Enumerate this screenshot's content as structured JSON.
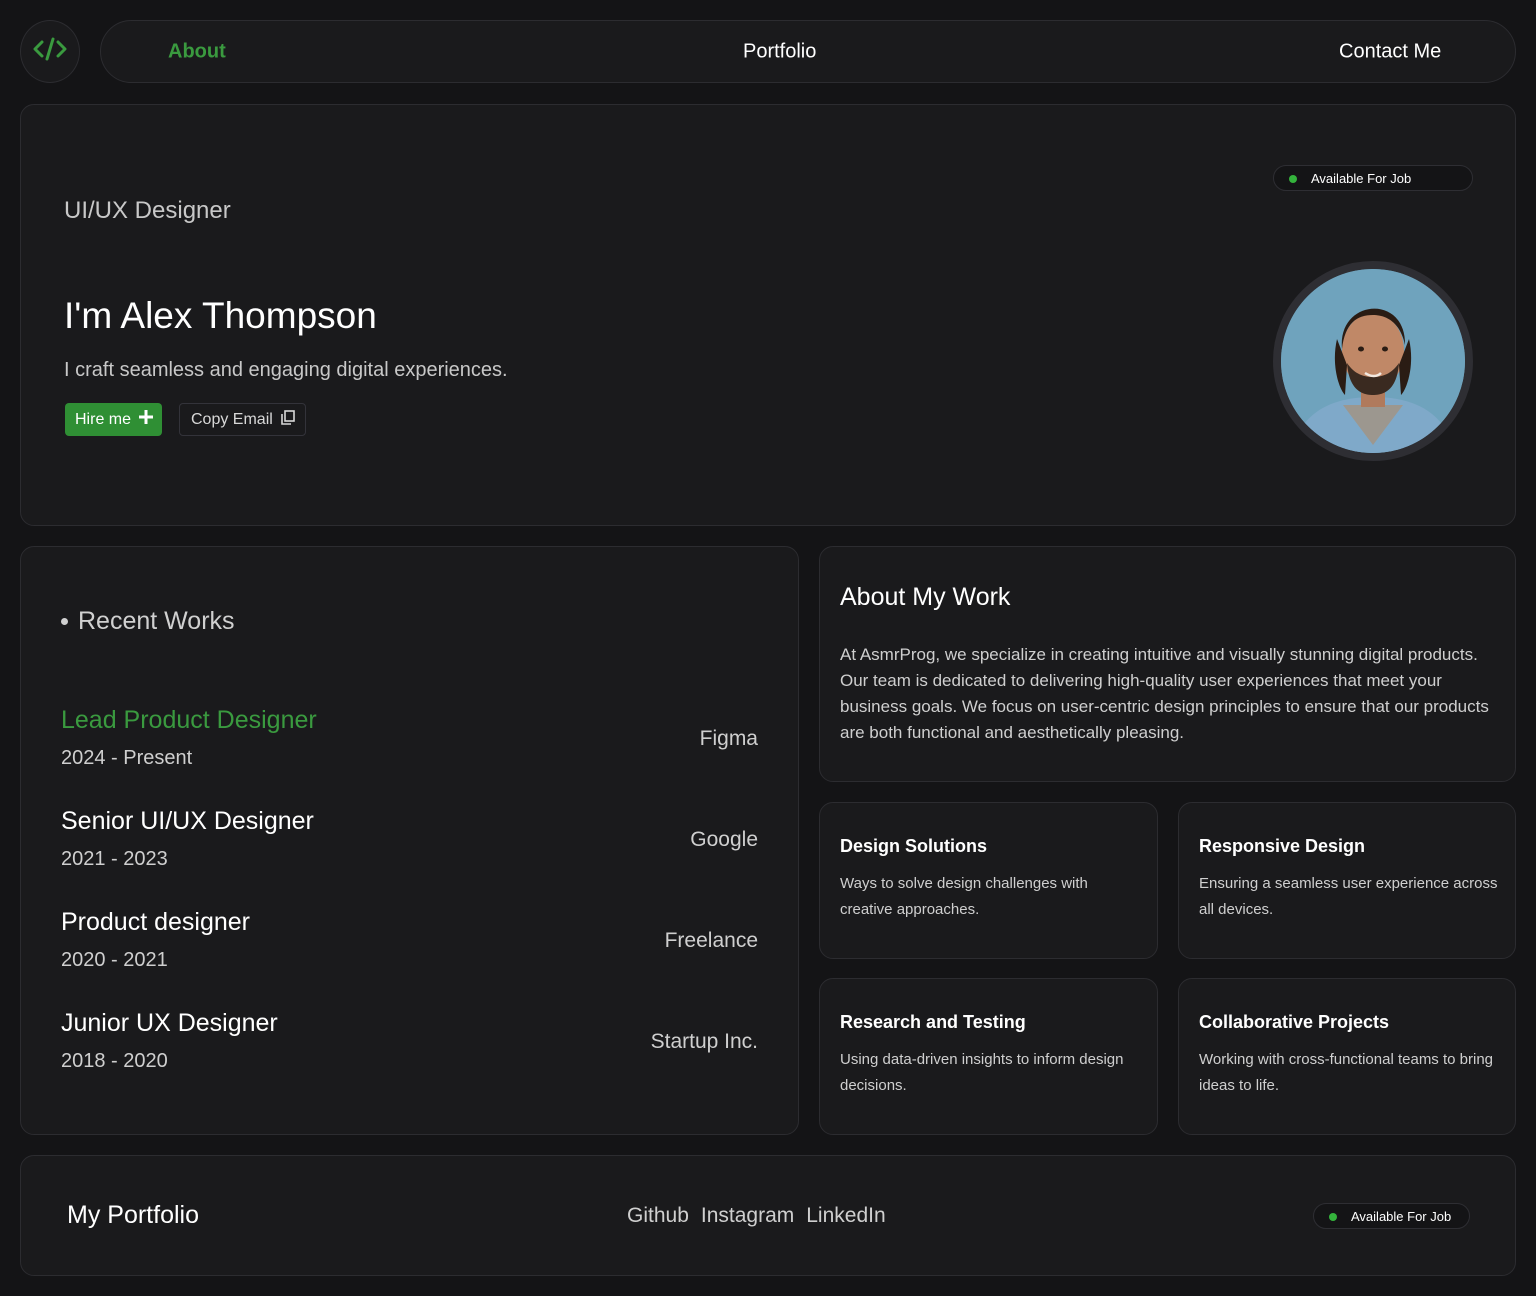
{
  "nav": {
    "links": [
      {
        "label": "About"
      },
      {
        "label": "Portfolio"
      },
      {
        "label": "Contact Me"
      }
    ]
  },
  "hero": {
    "role": "UI/UX Designer",
    "headline": "I'm Alex Thompson",
    "tagline": "I craft seamless and engaging digital experiences.",
    "hire_label": "Hire me",
    "copy_label": "Copy Email",
    "status": "Available For Job"
  },
  "works": {
    "title": "Recent Works",
    "items": [
      {
        "title": "Lead Product Designer",
        "years": "2024 - Present",
        "company": "Figma"
      },
      {
        "title": "Senior UI/UX Designer",
        "years": "2021 - 2023",
        "company": "Google"
      },
      {
        "title": "Product designer",
        "years": "2020 - 2021",
        "company": "Freelance"
      },
      {
        "title": "Junior UX Designer",
        "years": "2018 - 2020",
        "company": "Startup Inc."
      }
    ]
  },
  "about": {
    "title": "About My Work",
    "body": "At AsmrProg, we specialize in creating intuitive and visually stunning digital products. Our team is dedicated to delivering high-quality user experiences that meet your business goals. We focus on user-centric design principles to ensure that our products are both functional and aesthetically pleasing."
  },
  "services": [
    {
      "title": "Design Solutions",
      "desc": "Ways to solve design challenges with creative approaches."
    },
    {
      "title": "Responsive Design",
      "desc": "Ensuring a seamless user experience across all devices."
    },
    {
      "title": "Research and Testing",
      "desc": "Using data-driven insights to inform design decisions."
    },
    {
      "title": "Collaborative Projects",
      "desc": "Working with cross-functional teams to bring ideas to life."
    }
  ],
  "footer": {
    "brand": "My Portfolio",
    "links": [
      "Github",
      "Instagram",
      "LinkedIn"
    ],
    "status": "Available For Job"
  },
  "colors": {
    "accent": "#3a9a3f",
    "status_dot": "#34b33c",
    "background": "#141416",
    "card": "#1a1a1c"
  }
}
